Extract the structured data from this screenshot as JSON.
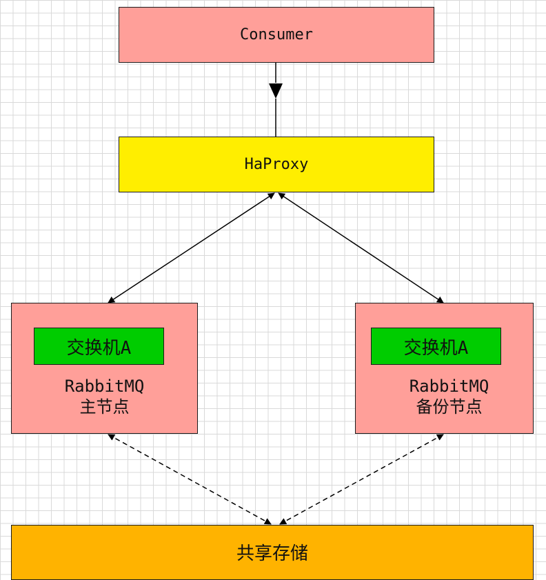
{
  "nodes": {
    "consumer": {
      "label": "Consumer",
      "color": "#ff9f99"
    },
    "haproxy": {
      "label": "HaProxy",
      "color": "#ffee00"
    },
    "rabbit_main": {
      "exchange": "交换机A",
      "name": "RabbitMQ",
      "role": "主节点",
      "color": "#ff9f99",
      "exchange_color": "#00cc00"
    },
    "rabbit_backup": {
      "exchange": "交换机A",
      "name": "RabbitMQ",
      "role": "备份节点",
      "color": "#ff9f99",
      "exchange_color": "#00cc00"
    },
    "storage": {
      "label": "共享存储",
      "color": "#ffb300"
    }
  },
  "edges": [
    {
      "from": "consumer",
      "to": "haproxy",
      "style": "solid",
      "arrows": "end"
    },
    {
      "from": "haproxy",
      "to": "rabbit_main",
      "style": "solid",
      "arrows": "both"
    },
    {
      "from": "haproxy",
      "to": "rabbit_backup",
      "style": "solid",
      "arrows": "both"
    },
    {
      "from": "rabbit_main",
      "to": "storage",
      "style": "dashed",
      "arrows": "both"
    },
    {
      "from": "rabbit_backup",
      "to": "storage",
      "style": "dashed",
      "arrows": "both"
    }
  ]
}
